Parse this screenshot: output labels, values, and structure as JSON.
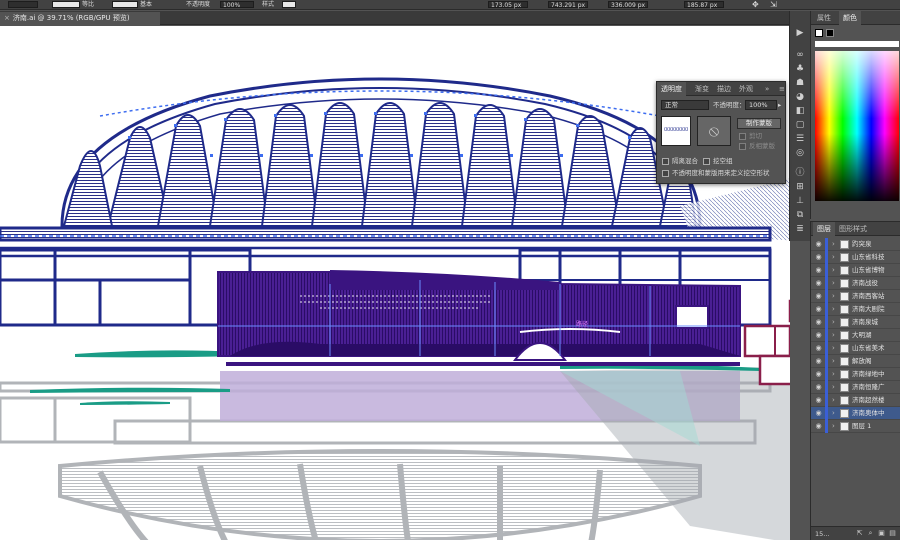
{
  "options_bar": {
    "stroke_label": "等比",
    "profile_label": "基本",
    "opacity_label": "不透明度",
    "opacity_value": "100%",
    "style_label": "样式",
    "x_value": "173.05 px",
    "y_value": "743.291 px",
    "w_value": "336.009 px",
    "h_value": "185.87 px"
  },
  "document_tab": {
    "close_glyph": "×",
    "title": "济南.ai @ 39.71% (RGB/GPU 预览)"
  },
  "color_panel": {
    "tabs": [
      "属性",
      "颜色"
    ],
    "active_tab": "颜色"
  },
  "transparency_panel": {
    "tabs": [
      "透明度",
      "渐变",
      "描边",
      "外观"
    ],
    "overflow": "»",
    "blend_mode": "正常",
    "opacity_label": "不透明度：",
    "opacity_value": "100%",
    "make_mask_button": "制作蒙版",
    "clip_label": "剪切",
    "invert_mask_label": "反相蒙版",
    "isolate_blending_label": "隔离混合",
    "knockout_group_label": "挖空组",
    "opacity_mask_define_label": "不透明度和蒙版用来定义挖空形状",
    "thumb_text": "ÜÜÜÜÜÜÜÜ"
  },
  "layers_panel": {
    "tabs": [
      "图层",
      "图形样式"
    ],
    "active_tab": "图层",
    "layers": [
      {
        "name": "趵突泉",
        "selected": false
      },
      {
        "name": "山东省科技",
        "selected": false
      },
      {
        "name": "山东省博物",
        "selected": false
      },
      {
        "name": "济南战役",
        "selected": false
      },
      {
        "name": "济南西客站",
        "selected": false
      },
      {
        "name": "济南大剧院",
        "selected": false
      },
      {
        "name": "济南泉城",
        "selected": false
      },
      {
        "name": "大明湖",
        "selected": false
      },
      {
        "name": "山东省美术",
        "selected": false
      },
      {
        "name": "解放阁",
        "selected": false
      },
      {
        "name": "济南绿地中",
        "selected": false
      },
      {
        "name": "济南恒隆广",
        "selected": false
      },
      {
        "name": "济南超然楼",
        "selected": false
      },
      {
        "name": "济南奥体中",
        "selected": true
      },
      {
        "name": "图层 1",
        "selected": false
      }
    ],
    "footer_count": "15..."
  },
  "canvas": {
    "selection_label": "路径"
  },
  "colors": {
    "stadium_blue": "#1f2a8a",
    "anchor_blue": "#3d6df0",
    "building_purple": "#3a1480",
    "teal": "#1a9c86",
    "maroon": "#8a1f4a",
    "reflection_gray": "#a9acb1",
    "reflection_purple": "#b9a6d6"
  }
}
